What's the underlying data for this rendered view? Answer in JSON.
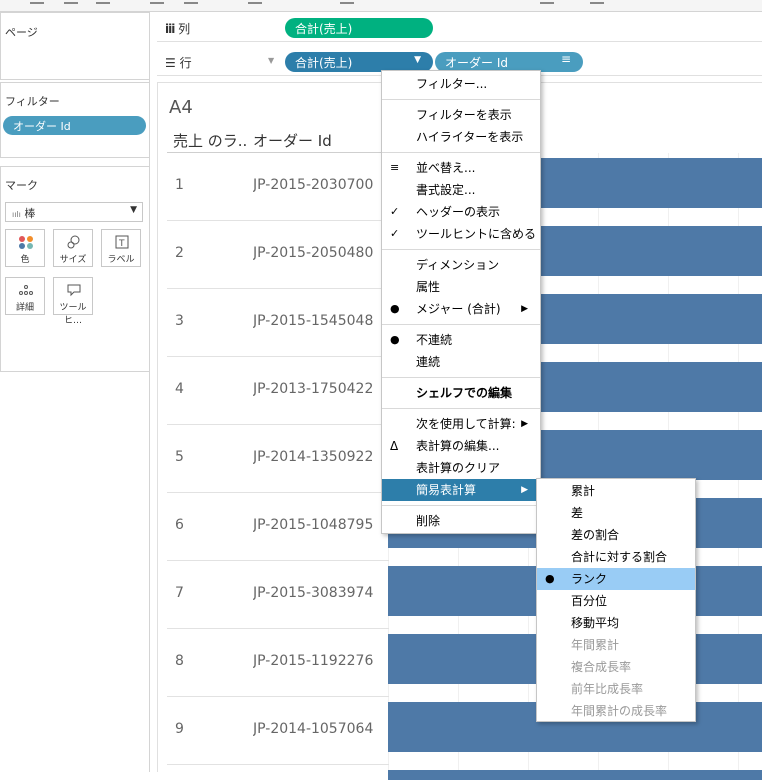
{
  "left_panel": {
    "pages_title": "ページ",
    "filters_title": "フィルター",
    "filter_pill": "オーダー Id",
    "marks_title": "マーク",
    "mark_type": "棒",
    "mark_buttons": [
      {
        "label": "色",
        "icon": "color-dots-icon"
      },
      {
        "label": "サイズ",
        "icon": "size-icon"
      },
      {
        "label": "ラベル",
        "icon": "label-icon"
      },
      {
        "label": "詳細",
        "icon": "detail-icon"
      },
      {
        "label": "ツールヒ…",
        "icon": "tooltip-icon"
      }
    ]
  },
  "shelves": {
    "columns_label": "列",
    "columns_pill": "合計(売上)",
    "rows_label": "行",
    "rows_pill_1": "合計(売上)",
    "rows_pill_2": "オーダー Id"
  },
  "view": {
    "title": "A4",
    "col_header_1": "売上 のラ..",
    "col_header_2": "オーダー Id",
    "rows": [
      {
        "rank": "1",
        "order_id": "JP-2015-2030700"
      },
      {
        "rank": "2",
        "order_id": "JP-2015-2050480"
      },
      {
        "rank": "3",
        "order_id": "JP-2015-1545048"
      },
      {
        "rank": "4",
        "order_id": "JP-2013-1750422"
      },
      {
        "rank": "5",
        "order_id": "JP-2014-1350922"
      },
      {
        "rank": "6",
        "order_id": "JP-2015-1048795"
      },
      {
        "rank": "7",
        "order_id": "JP-2015-3083974"
      },
      {
        "rank": "8",
        "order_id": "JP-2015-1192276"
      },
      {
        "rank": "9",
        "order_id": "JP-2014-1057064"
      }
    ]
  },
  "context_menu": {
    "items": [
      {
        "label": "フィルター..."
      },
      {
        "label": "フィルターを表示"
      },
      {
        "label": "ハイライターを表示"
      },
      {
        "label": "並べ替え..."
      },
      {
        "label": "書式設定..."
      },
      {
        "label": "ヘッダーの表示"
      },
      {
        "label": "ツールヒントに含める"
      },
      {
        "label": "ディメンション"
      },
      {
        "label": "属性"
      },
      {
        "label": "メジャー (合計)"
      },
      {
        "label": "不連続"
      },
      {
        "label": "連続"
      },
      {
        "label": "シェルフでの編集"
      },
      {
        "label": "次を使用して計算:"
      },
      {
        "label": "表計算の編集..."
      },
      {
        "label": "表計算のクリア"
      },
      {
        "label": "簡易表計算"
      },
      {
        "label": "削除"
      }
    ]
  },
  "submenu": {
    "items": [
      {
        "label": "累計"
      },
      {
        "label": "差"
      },
      {
        "label": "差の割合"
      },
      {
        "label": "合計に対する割合"
      },
      {
        "label": "ランク"
      },
      {
        "label": "百分位"
      },
      {
        "label": "移動平均"
      },
      {
        "label": "年間累計"
      },
      {
        "label": "複合成長率"
      },
      {
        "label": "前年比成長率"
      },
      {
        "label": "年間累計の成長率"
      }
    ]
  },
  "colors": {
    "bar": "#4e79a7",
    "pill_green": "#00b180",
    "pill_blue": "#2d7eaa",
    "highlight": "#99ccf5"
  }
}
